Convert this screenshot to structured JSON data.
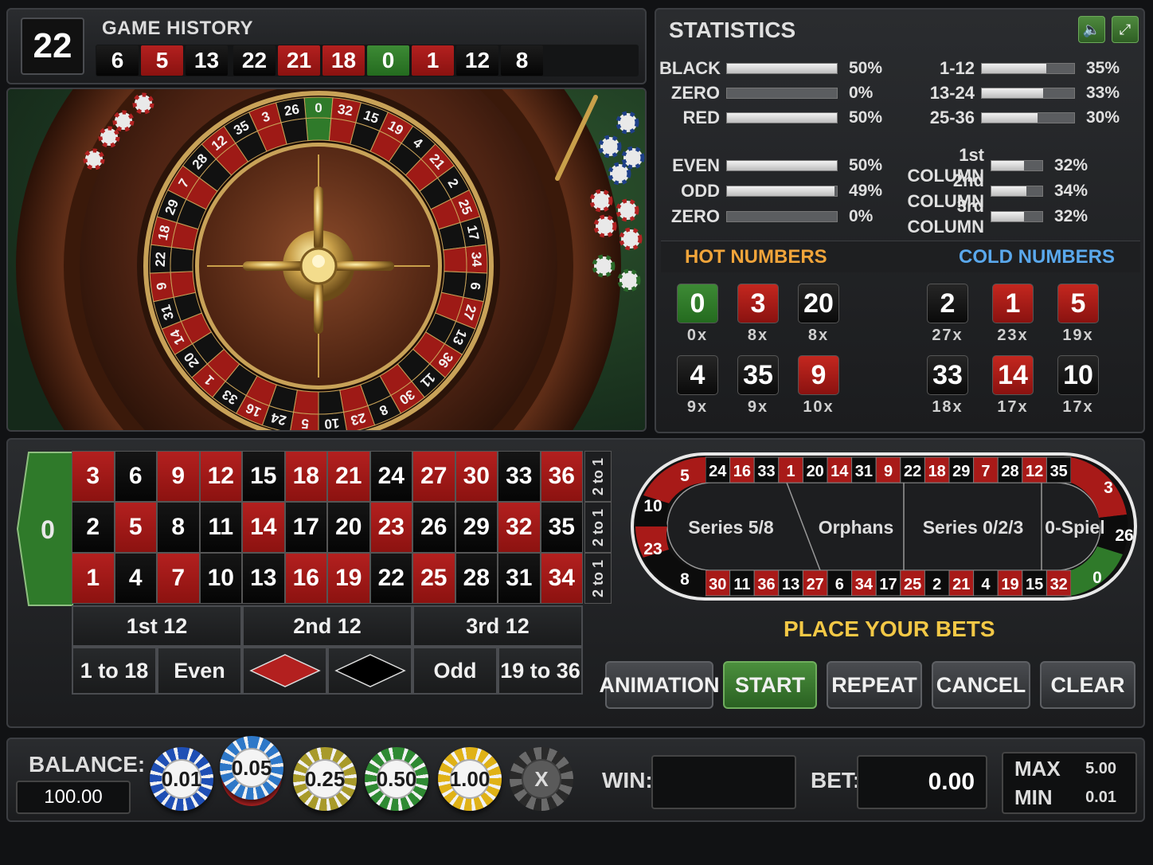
{
  "history": {
    "title": "GAME HISTORY",
    "last_number": "22",
    "results": [
      {
        "n": "6",
        "c": "black"
      },
      {
        "n": "5",
        "c": "red"
      },
      {
        "n": "13",
        "c": "black"
      },
      {
        "n": "22",
        "c": "black"
      },
      {
        "n": "21",
        "c": "red"
      },
      {
        "n": "18",
        "c": "red"
      },
      {
        "n": "0",
        "c": "green"
      },
      {
        "n": "1",
        "c": "red"
      },
      {
        "n": "12",
        "c": "black"
      },
      {
        "n": "8",
        "c": "black"
      }
    ]
  },
  "statistics": {
    "title": "STATISTICS",
    "sound_icon": "speaker-icon",
    "fullscreen_icon": "fullscreen-icon",
    "left_top": [
      {
        "label": "BLACK",
        "pct": "50%",
        "value": 50
      },
      {
        "label": "ZERO",
        "pct": "0%",
        "value": 0
      },
      {
        "label": "RED",
        "pct": "50%",
        "value": 50
      }
    ],
    "left_bottom": [
      {
        "label": "EVEN",
        "pct": "50%",
        "value": 50
      },
      {
        "label": "ODD",
        "pct": "49%",
        "value": 49
      },
      {
        "label": "ZERO",
        "pct": "0%",
        "value": 0
      }
    ],
    "right_top": [
      {
        "label": "1-12",
        "pct": "35%",
        "value": 35
      },
      {
        "label": "13-24",
        "pct": "33%",
        "value": 33
      },
      {
        "label": "25-36",
        "pct": "30%",
        "value": 30
      }
    ],
    "right_bottom": [
      {
        "label": "1st COLUMN",
        "pct": "32%",
        "value": 32
      },
      {
        "label": "2nd COLUMN",
        "pct": "34%",
        "value": 34
      },
      {
        "label": "3rd COLUMN",
        "pct": "32%",
        "value": 32
      }
    ],
    "hot_title": "HOT NUMBERS",
    "cold_title": "COLD NUMBERS",
    "hot": [
      {
        "n": "0",
        "c": "green",
        "count": "0x"
      },
      {
        "n": "3",
        "c": "red",
        "count": "8x"
      },
      {
        "n": "20",
        "c": "black",
        "count": "8x"
      },
      {
        "n": "4",
        "c": "black",
        "count": "9x"
      },
      {
        "n": "35",
        "c": "black",
        "count": "9x"
      },
      {
        "n": "9",
        "c": "red",
        "count": "10x"
      }
    ],
    "cold": [
      {
        "n": "2",
        "c": "black",
        "count": "27x"
      },
      {
        "n": "1",
        "c": "red",
        "count": "23x"
      },
      {
        "n": "5",
        "c": "red",
        "count": "19x"
      },
      {
        "n": "33",
        "c": "black",
        "count": "18x"
      },
      {
        "n": "14",
        "c": "red",
        "count": "17x"
      },
      {
        "n": "10",
        "c": "black",
        "count": "17x"
      }
    ],
    "colors": {
      "hot": "#f0a43a",
      "cold": "#5aa8ec"
    }
  },
  "wheel": {
    "sequence": [
      "0",
      "32",
      "15",
      "19",
      "4",
      "21",
      "2",
      "25",
      "17",
      "34",
      "6",
      "27",
      "13",
      "36",
      "11",
      "30",
      "8",
      "23",
      "10",
      "5",
      "24",
      "16",
      "33",
      "1",
      "20",
      "14",
      "31",
      "9",
      "22",
      "18",
      "29",
      "7",
      "28",
      "12",
      "35",
      "3",
      "26"
    ]
  },
  "table": {
    "zero": "0",
    "rows": [
      [
        {
          "n": "3",
          "c": "red"
        },
        {
          "n": "6",
          "c": "black"
        },
        {
          "n": "9",
          "c": "red"
        },
        {
          "n": "12",
          "c": "red"
        },
        {
          "n": "15",
          "c": "black"
        },
        {
          "n": "18",
          "c": "red"
        },
        {
          "n": "21",
          "c": "red"
        },
        {
          "n": "24",
          "c": "black"
        },
        {
          "n": "27",
          "c": "red"
        },
        {
          "n": "30",
          "c": "red"
        },
        {
          "n": "33",
          "c": "black"
        },
        {
          "n": "36",
          "c": "red"
        }
      ],
      [
        {
          "n": "2",
          "c": "black"
        },
        {
          "n": "5",
          "c": "red"
        },
        {
          "n": "8",
          "c": "black"
        },
        {
          "n": "11",
          "c": "black"
        },
        {
          "n": "14",
          "c": "red"
        },
        {
          "n": "17",
          "c": "black"
        },
        {
          "n": "20",
          "c": "black"
        },
        {
          "n": "23",
          "c": "red"
        },
        {
          "n": "26",
          "c": "black"
        },
        {
          "n": "29",
          "c": "black"
        },
        {
          "n": "32",
          "c": "red"
        },
        {
          "n": "35",
          "c": "black"
        }
      ],
      [
        {
          "n": "1",
          "c": "red"
        },
        {
          "n": "4",
          "c": "black"
        },
        {
          "n": "7",
          "c": "red"
        },
        {
          "n": "10",
          "c": "black"
        },
        {
          "n": "13",
          "c": "black"
        },
        {
          "n": "16",
          "c": "red"
        },
        {
          "n": "19",
          "c": "red"
        },
        {
          "n": "22",
          "c": "black"
        },
        {
          "n": "25",
          "c": "red"
        },
        {
          "n": "28",
          "c": "black"
        },
        {
          "n": "31",
          "c": "black"
        },
        {
          "n": "34",
          "c": "red"
        }
      ]
    ],
    "column_bet": "2 to 1",
    "dozens": [
      "1st 12",
      "2nd 12",
      "3rd 12"
    ],
    "low": "1 to 18",
    "even": "Even",
    "odd": "Odd",
    "high": "19 to 36",
    "red_icon": "red-diamond-icon",
    "black_icon": "black-diamond-icon"
  },
  "racetrack": {
    "top": [
      {
        "n": "24",
        "c": "black"
      },
      {
        "n": "16",
        "c": "red"
      },
      {
        "n": "33",
        "c": "black"
      },
      {
        "n": "1",
        "c": "red"
      },
      {
        "n": "20",
        "c": "black"
      },
      {
        "n": "14",
        "c": "red"
      },
      {
        "n": "31",
        "c": "black"
      },
      {
        "n": "9",
        "c": "red"
      },
      {
        "n": "22",
        "c": "black"
      },
      {
        "n": "18",
        "c": "red"
      },
      {
        "n": "29",
        "c": "black"
      },
      {
        "n": "7",
        "c": "red"
      },
      {
        "n": "28",
        "c": "black"
      },
      {
        "n": "12",
        "c": "red"
      },
      {
        "n": "35",
        "c": "black"
      }
    ],
    "bottom": [
      {
        "n": "30",
        "c": "red"
      },
      {
        "n": "11",
        "c": "black"
      },
      {
        "n": "36",
        "c": "red"
      },
      {
        "n": "13",
        "c": "black"
      },
      {
        "n": "27",
        "c": "red"
      },
      {
        "n": "6",
        "c": "black"
      },
      {
        "n": "34",
        "c": "red"
      },
      {
        "n": "17",
        "c": "black"
      },
      {
        "n": "25",
        "c": "red"
      },
      {
        "n": "2",
        "c": "black"
      },
      {
        "n": "21",
        "c": "red"
      },
      {
        "n": "4",
        "c": "black"
      },
      {
        "n": "19",
        "c": "red"
      },
      {
        "n": "15",
        "c": "black"
      },
      {
        "n": "32",
        "c": "red"
      }
    ],
    "left_end": [
      {
        "n": "5",
        "c": "red"
      },
      {
        "n": "10",
        "c": "black"
      },
      {
        "n": "23",
        "c": "red"
      },
      {
        "n": "8",
        "c": "black"
      }
    ],
    "right_end": [
      {
        "n": "3",
        "c": "red"
      },
      {
        "n": "26",
        "c": "black"
      },
      {
        "n": "0",
        "c": "green"
      }
    ],
    "sections": [
      "Series 5/8",
      "Orphans",
      "Series 0/2/3",
      "0-Spiel"
    ]
  },
  "controls": {
    "prompt": "PLACE YOUR BETS",
    "buttons": [
      "ANIMATION",
      "START",
      "REPEAT",
      "CANCEL",
      "CLEAR"
    ]
  },
  "bottom": {
    "balance_label": "BALANCE:",
    "balance": "100.00",
    "chips": [
      {
        "value": "0.01",
        "color": "#1f4fb5"
      },
      {
        "value": "0.05",
        "color": "#2e78c8"
      },
      {
        "value": "0.25",
        "color": "#a89a2a"
      },
      {
        "value": "0.50",
        "color": "#2f8a33"
      },
      {
        "value": "1.00",
        "color": "#e0b217"
      }
    ],
    "clear_chip": "X",
    "win_label": "WIN:",
    "win": "",
    "bet_label": "BET:",
    "bet": "0.00",
    "max_label": "MAX",
    "max": "5.00",
    "min_label": "MIN",
    "min": "0.01"
  }
}
